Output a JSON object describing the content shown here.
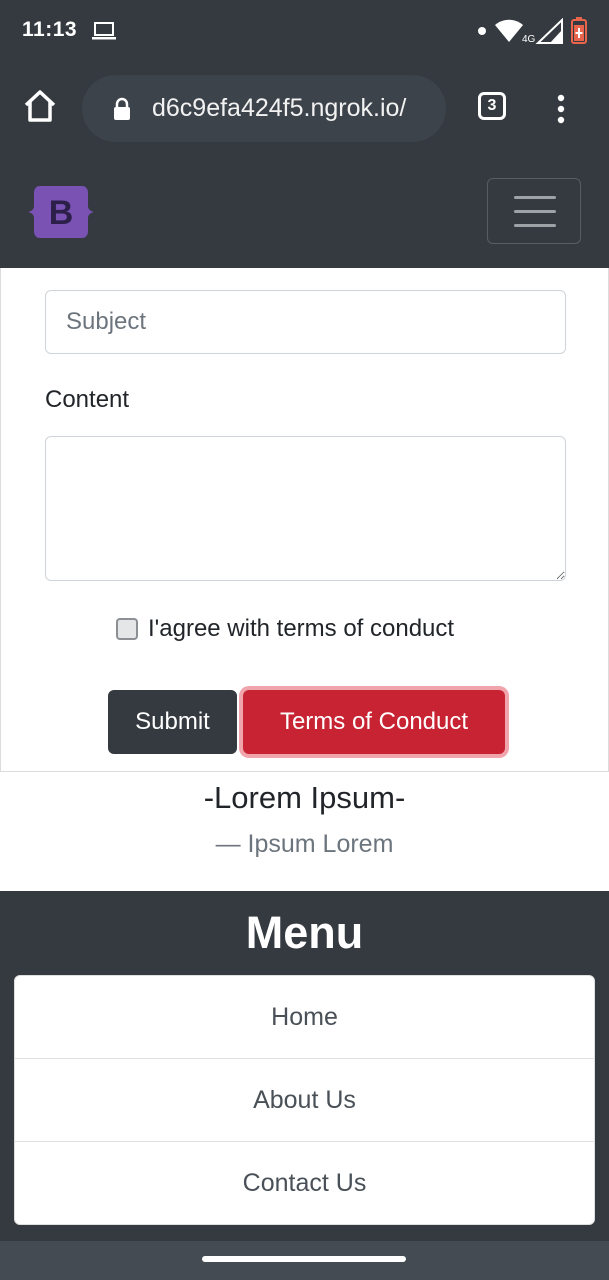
{
  "status_bar": {
    "time": "11:13",
    "network_label": "4G",
    "icons": [
      "laptop-icon",
      "notification-dot-icon",
      "wifi-icon",
      "cell-signal-icon",
      "battery-icon"
    ]
  },
  "browser": {
    "url": "d6c9efa424f5.ngrok.io/",
    "tab_count": "3",
    "icons": [
      "home-icon",
      "lock-icon",
      "tabs-icon",
      "overflow-menu-icon"
    ]
  },
  "navbar": {
    "brand_letter": "B",
    "brand_color": "#7952b3",
    "toggler_icon": "hamburger-icon"
  },
  "form": {
    "subject_placeholder": "Subject",
    "subject_value": "",
    "content_label": "Content",
    "content_value": "",
    "agree_label": "I'agree with terms of conduct",
    "agree_checked": false,
    "submit_label": "Submit",
    "terms_label": "Terms of Conduct"
  },
  "quote": {
    "title": "-Lorem Ipsum-",
    "footer": "— Ipsum Lorem"
  },
  "footer_menu": {
    "title": "Menu",
    "items": [
      {
        "label": "Home"
      },
      {
        "label": "About Us"
      },
      {
        "label": "Contact Us"
      }
    ]
  },
  "colors": {
    "dark": "#343a40",
    "danger": "#c82333",
    "secondary_text": "#6c757d"
  }
}
